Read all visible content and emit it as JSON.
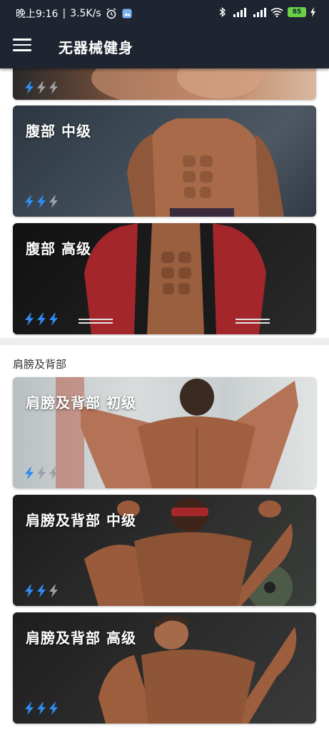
{
  "status_bar": {
    "time": "晚上9:16",
    "separator": "|",
    "net_speed": "3.5K/s",
    "battery": "85",
    "icons": [
      "alarm-icon",
      "app-badge-icon",
      "bluetooth-icon",
      "signal-hd-icon",
      "signal-hd-icon",
      "wifi-icon",
      "battery-icon",
      "charging-icon"
    ]
  },
  "app_bar": {
    "menu_icon": "hamburger-menu-icon",
    "title": "无器械健身"
  },
  "sections": [
    {
      "label": "",
      "cards": [
        {
          "title": "",
          "level": 1
        },
        {
          "title": "腹部 中级",
          "level": 2
        },
        {
          "title": "腹部 高级",
          "level": 3
        }
      ]
    },
    {
      "label": "肩膀及背部",
      "cards": [
        {
          "title": "肩膀及背部 初级",
          "level": 1
        },
        {
          "title": "肩膀及背部 中级",
          "level": 2
        },
        {
          "title": "肩膀及背部 高级",
          "level": 3
        }
      ]
    }
  ],
  "colors": {
    "appbar_bg": "#1e2530",
    "bolt_active": "#2f8cf2",
    "bolt_inactive": "#9aa0a6",
    "section_label": "#333333"
  },
  "icons": {
    "bolt": "lightning-bolt-icon"
  }
}
